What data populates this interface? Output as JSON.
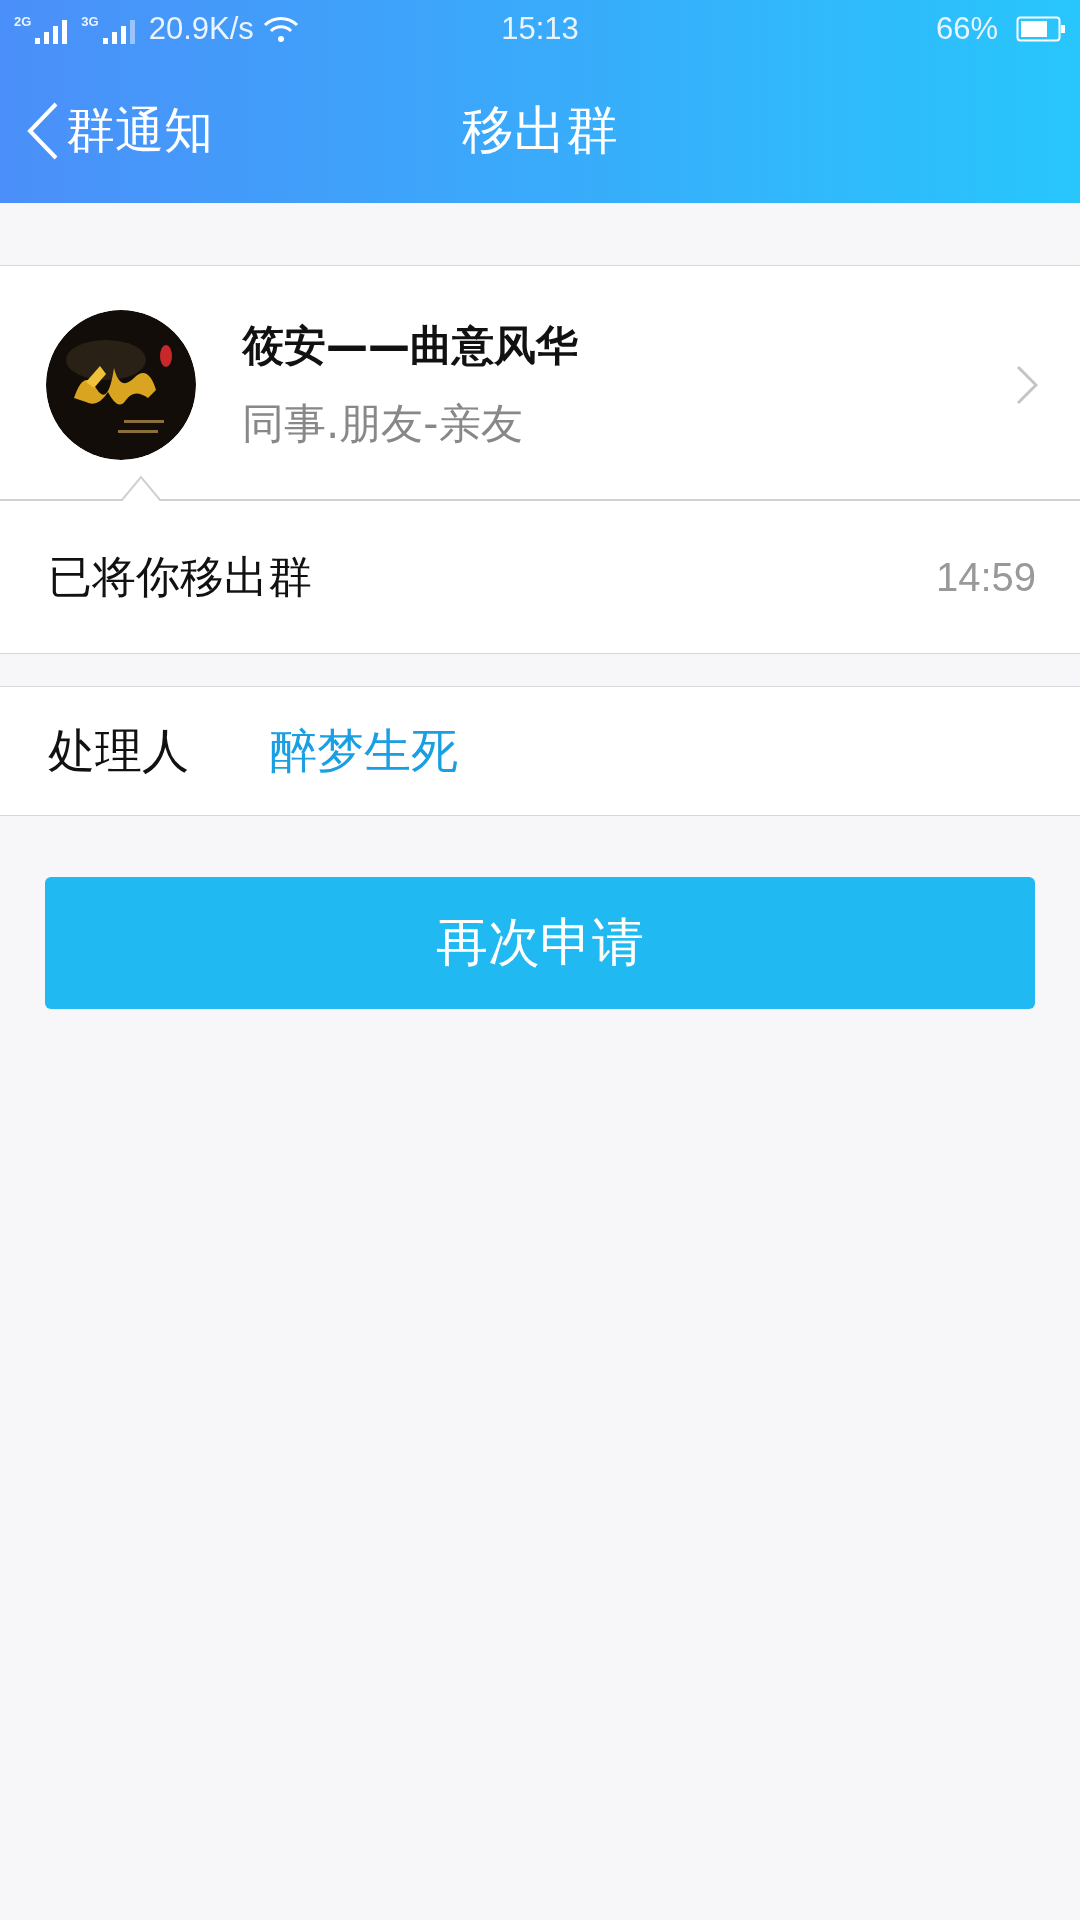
{
  "status_bar": {
    "network_1": "2G",
    "network_2": "3G",
    "speed": "20.9K/s",
    "time": "15:13",
    "battery": "66%"
  },
  "header": {
    "back_label": "群通知",
    "title": "移出群"
  },
  "group": {
    "name": "筱安——曲意风华",
    "category": "同事.朋友-亲友"
  },
  "notice": {
    "message": "已将你移出群",
    "time": "14:59"
  },
  "handler": {
    "label": "处理人",
    "name": "醉梦生死"
  },
  "button": "再次申请"
}
